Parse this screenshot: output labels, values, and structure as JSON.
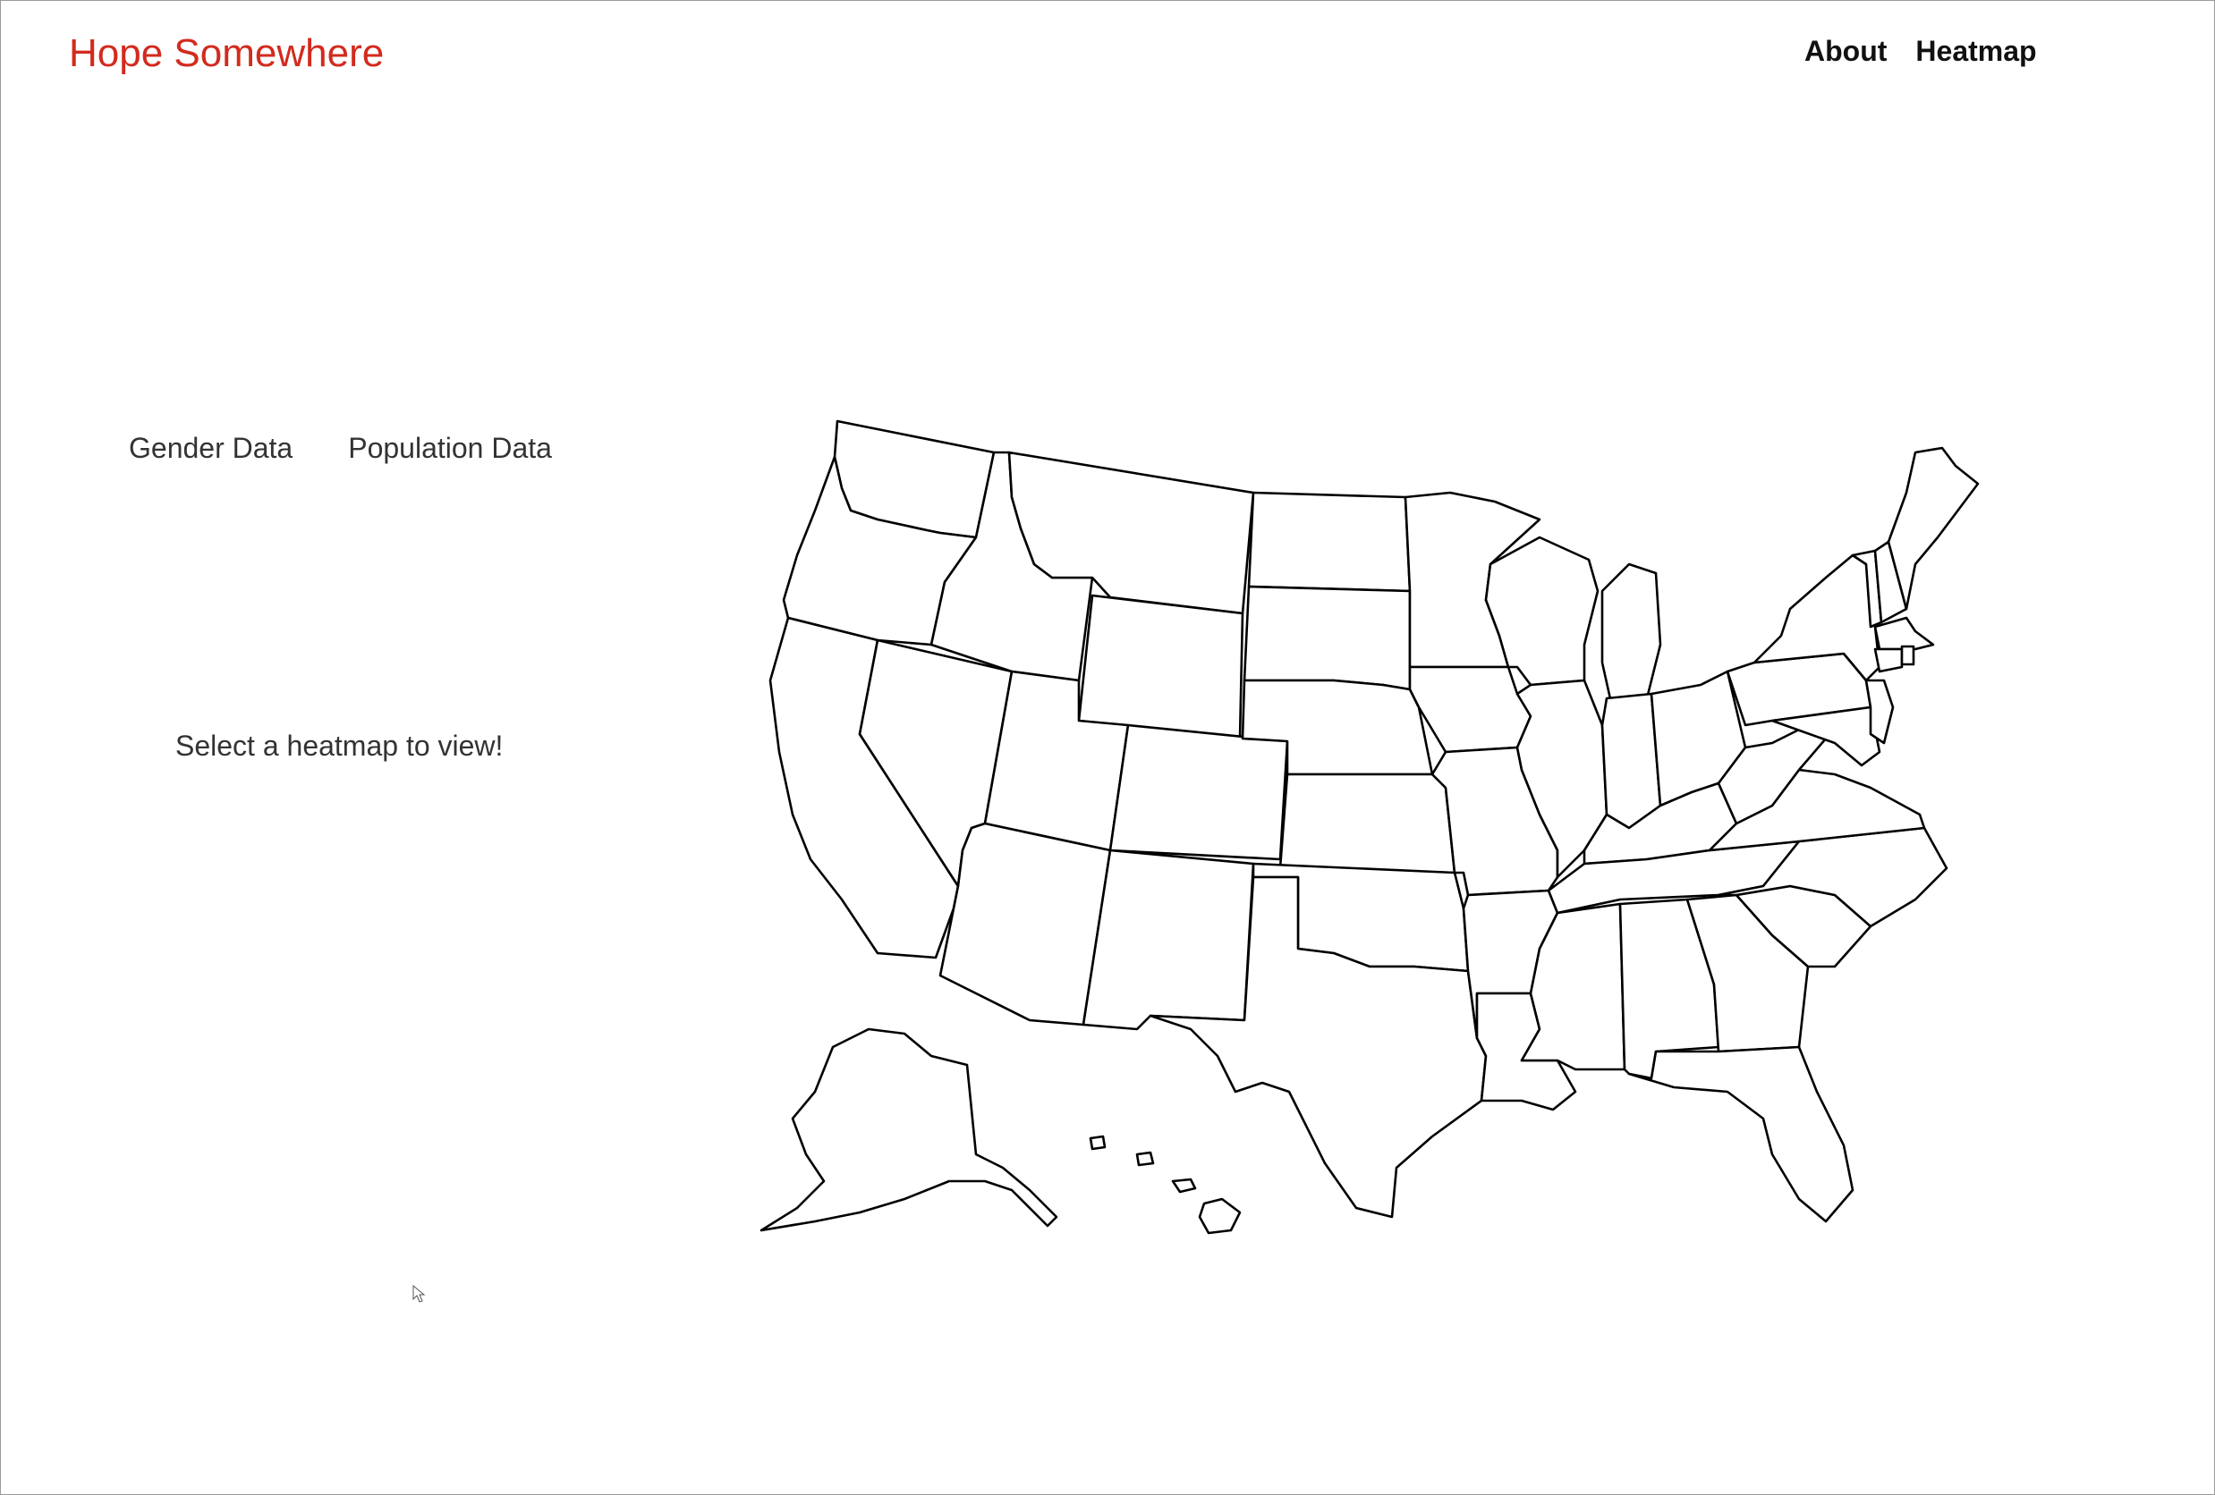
{
  "header": {
    "brand": "Hope Somewhere",
    "nav": [
      {
        "label": "About"
      },
      {
        "label": "Heatmap"
      }
    ]
  },
  "tabs": [
    {
      "label": "Gender Data"
    },
    {
      "label": "Population Data"
    }
  ],
  "prompt": "Select a heatmap to view!",
  "colors": {
    "brand": "#d22b1e",
    "map_fill": "#ffffff",
    "map_stroke": "#000000"
  }
}
